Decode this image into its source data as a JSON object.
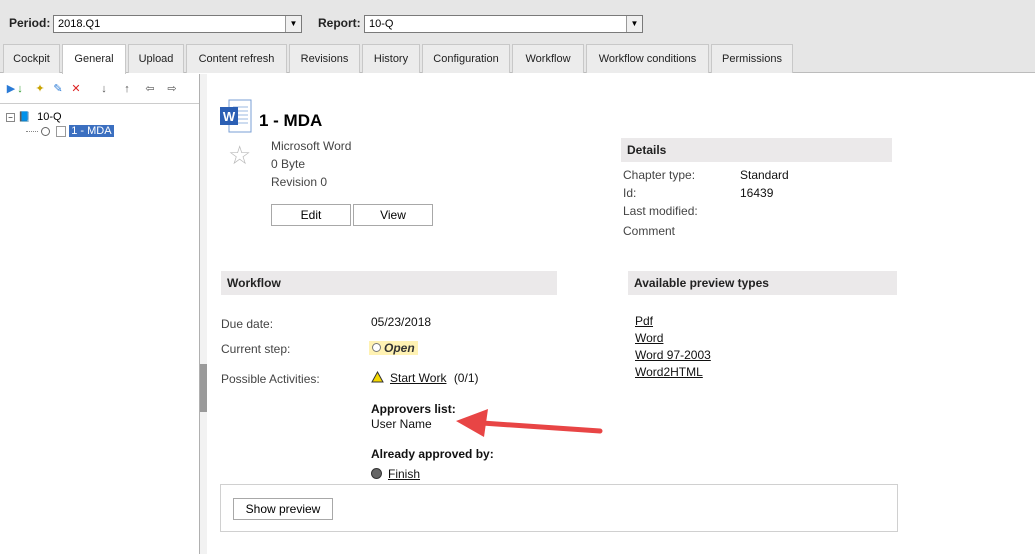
{
  "topbar": {
    "period_label": "Period:",
    "period_value": "2018.Q1",
    "report_label": "Report:",
    "report_value": "10-Q"
  },
  "tabs": [
    {
      "label": "Cockpit"
    },
    {
      "label": "General"
    },
    {
      "label": "Upload"
    },
    {
      "label": "Content refresh"
    },
    {
      "label": "Revisions"
    },
    {
      "label": "History"
    },
    {
      "label": "Configuration"
    },
    {
      "label": "Workflow"
    },
    {
      "label": "Workflow conditions"
    },
    {
      "label": "Permissions"
    }
  ],
  "active_tab": "General",
  "tree": {
    "root": "10-Q",
    "child": "1 - MDA"
  },
  "document": {
    "title": "1 - MDA",
    "type": "Microsoft Word",
    "size": "0 Byte",
    "revision": "Revision 0",
    "edit_label": "Edit",
    "view_label": "View"
  },
  "details": {
    "header": "Details",
    "chapter_type_label": "Chapter type:",
    "chapter_type_value": "Standard",
    "id_label": "Id:",
    "id_value": "16439",
    "last_modified_label": "Last modified:",
    "comment_label": "Comment"
  },
  "workflow": {
    "header": "Workflow",
    "due_date_label": "Due date:",
    "due_date_value": "05/23/2018",
    "current_step_label": "Current step:",
    "current_step_value": "Open",
    "possible_activities_label": "Possible Activities:",
    "start_work_link": "Start Work",
    "start_work_count": "(0/1)",
    "approvers_label": "Approvers list:",
    "approver_name": "User Name",
    "already_approved_label": "Already approved by:",
    "finish_link": "Finish"
  },
  "preview_types": {
    "header": "Available preview types",
    "items": [
      "Pdf",
      "Word",
      "Word 97-2003",
      "Word2HTML"
    ]
  },
  "show_preview_label": "Show preview",
  "colors": {
    "accent_arrow": "#e84545",
    "selection": "#3b6fc0",
    "open_badge": "#fff2b3"
  }
}
